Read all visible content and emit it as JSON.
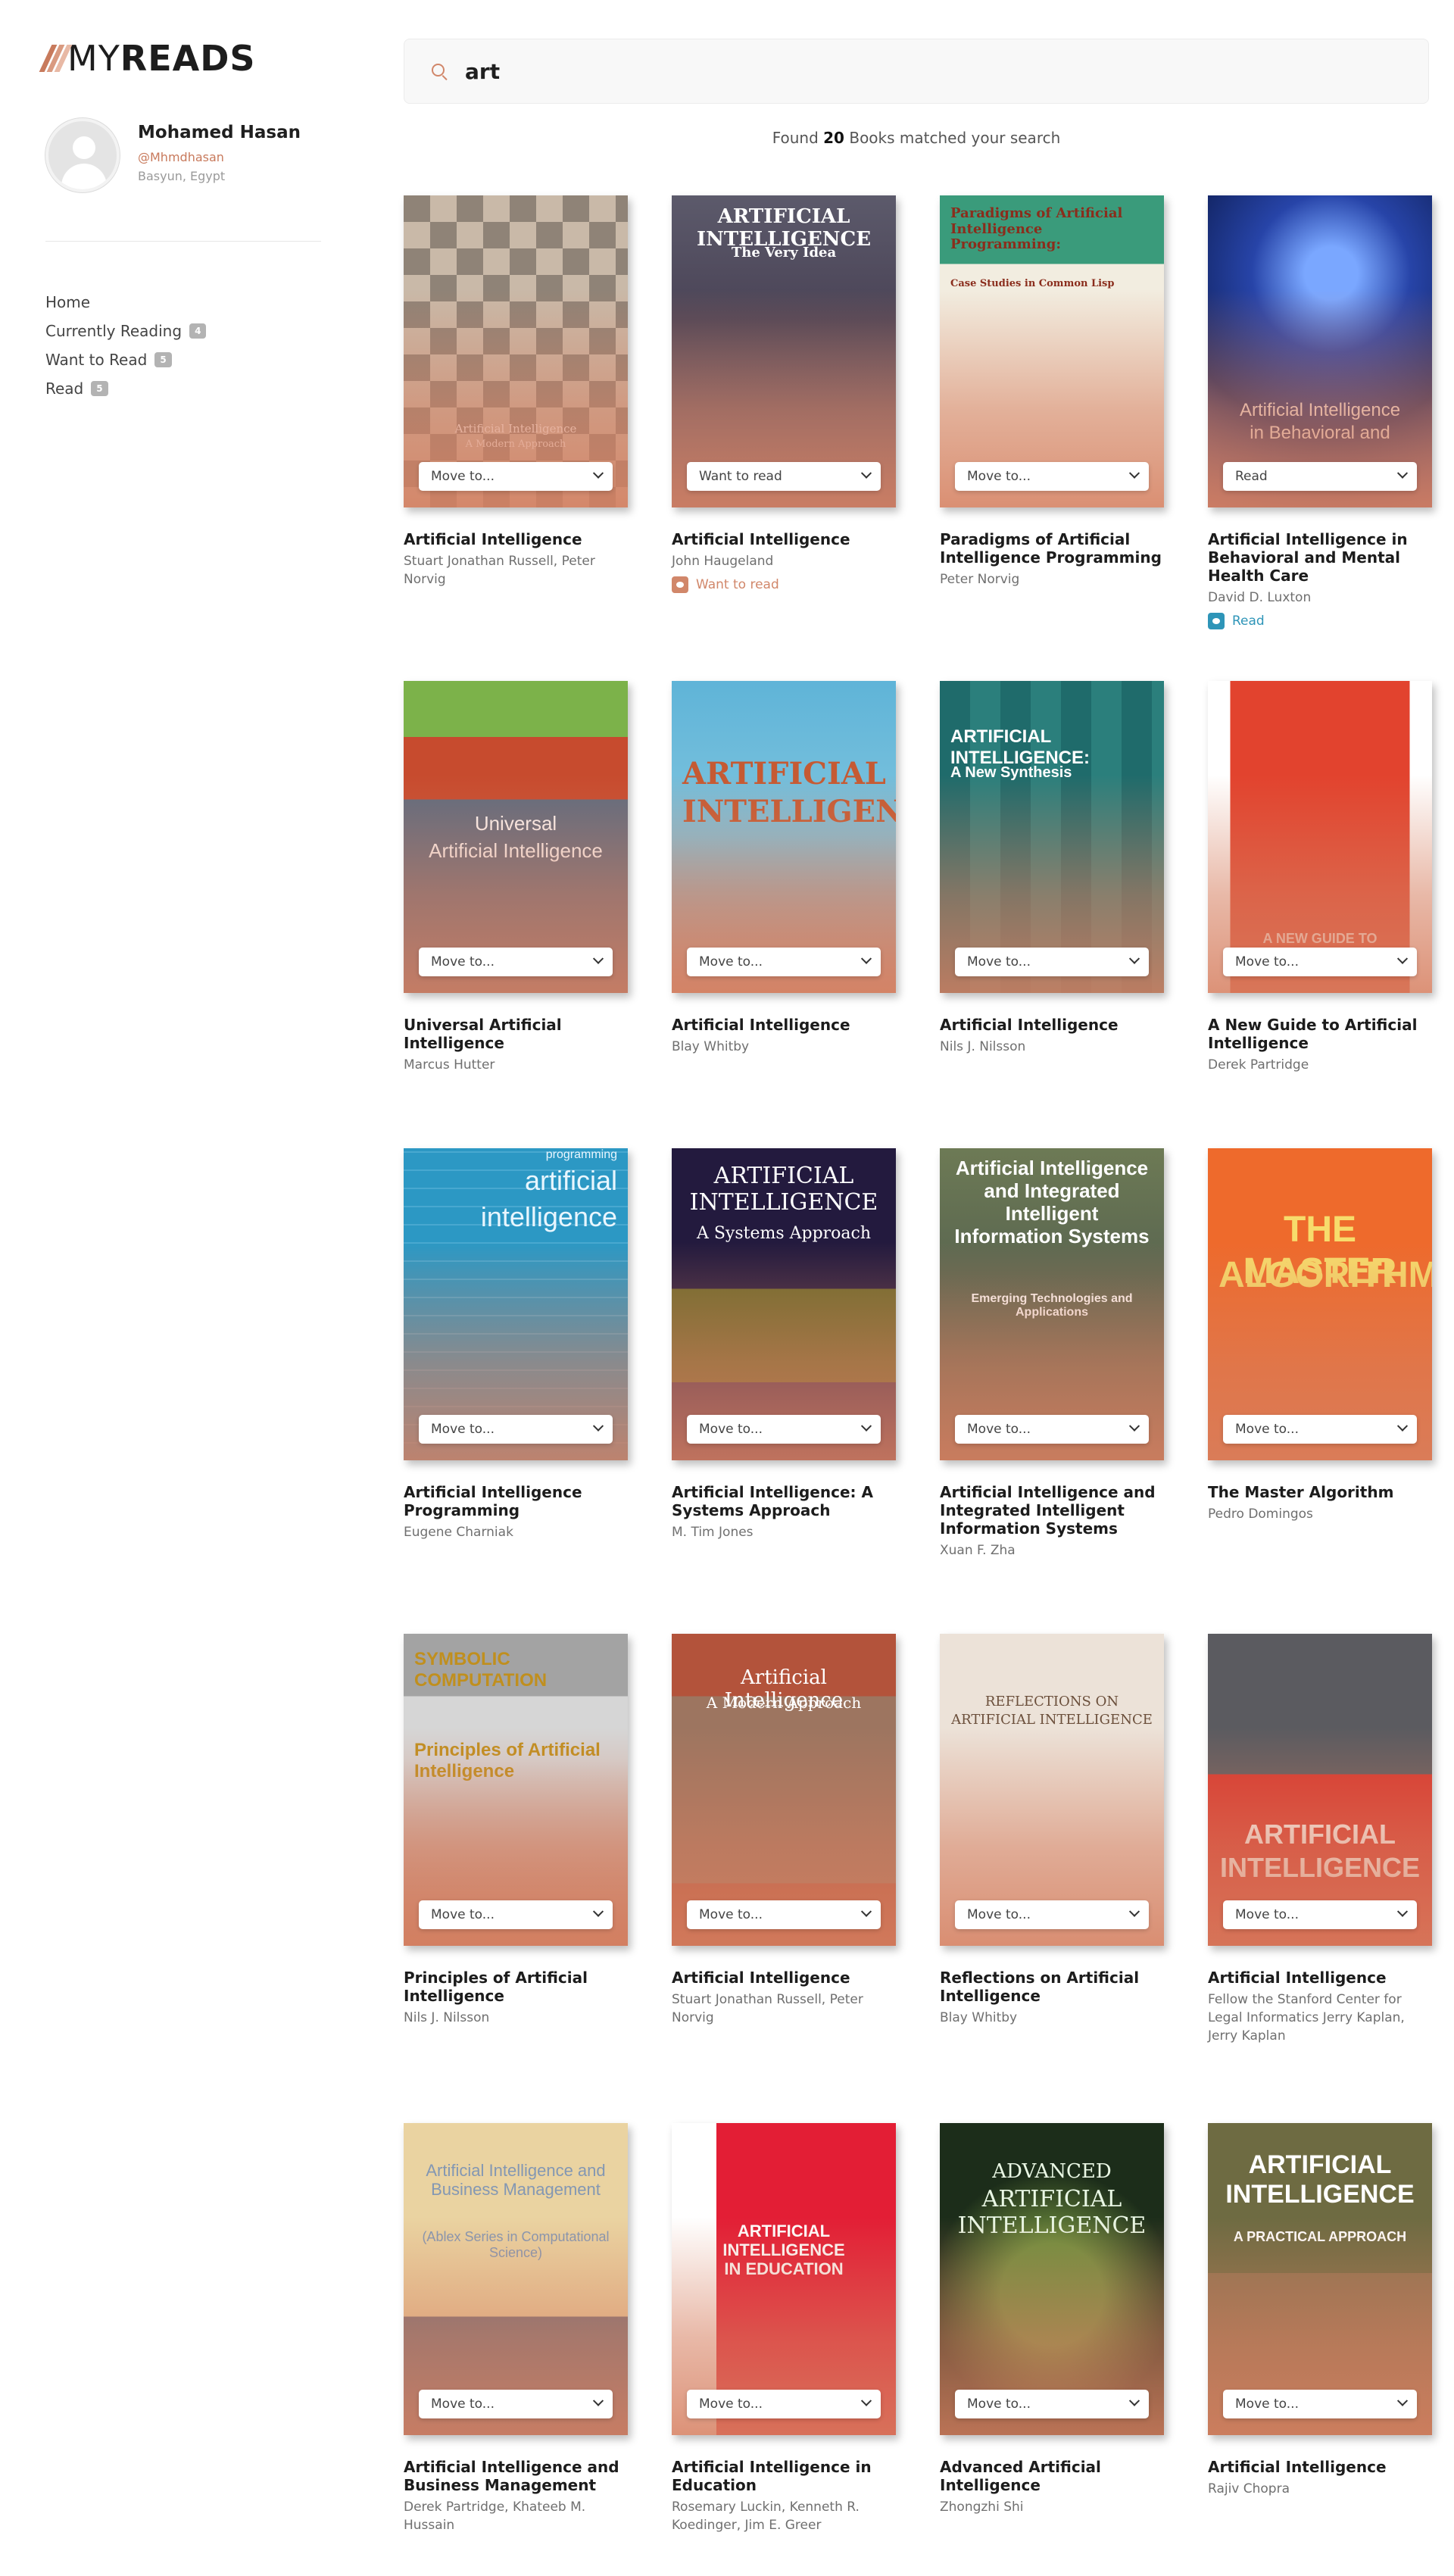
{
  "brand": {
    "logo_light": "MY",
    "logo_bold": "READS"
  },
  "profile": {
    "name": "Mohamed Hasan",
    "handle": "@Mhmdhasan",
    "location": "Basyun, Egypt"
  },
  "nav": [
    {
      "label": "Home",
      "badge": ""
    },
    {
      "label": "Currently Reading",
      "badge": "4"
    },
    {
      "label": "Want to Read",
      "badge": "5"
    },
    {
      "label": "Read",
      "badge": "5"
    }
  ],
  "search": {
    "value": "art",
    "placeholder": "Search by title or author"
  },
  "results": {
    "prefix": "Found",
    "count": "20",
    "suffix": "Books matched your search"
  },
  "colors": {
    "accent": "#c87a5c",
    "want_to_read": "#d1876a",
    "read": "#2e95b8"
  },
  "books": [
    {
      "title": "Artificial Intelligence",
      "authors": "Stuart Jonathan Russell, Peter Norvig",
      "shelf": "Move to...",
      "status": "",
      "cover_lines": [
        "Artificial Intelligence",
        "A Modern Approach"
      ]
    },
    {
      "title": "Artificial Intelligence",
      "authors": "John Haugeland",
      "shelf": "Want to read",
      "status": "Want to read",
      "cover_lines": [
        "ARTIFICIAL INTELLIGENCE",
        "The Very Idea"
      ]
    },
    {
      "title": "Paradigms of Artificial Intelligence Programming",
      "authors": "Peter Norvig",
      "shelf": "Move to...",
      "status": "",
      "cover_lines": [
        "Paradigms of Artificial Intelligence Programming:",
        "Case Studies in Common Lisp"
      ]
    },
    {
      "title": "Artificial Intelligence in Behavioral and Mental Health Care",
      "authors": "David D. Luxton",
      "shelf": "Read",
      "status": "Read",
      "cover_lines": [
        "Artificial Intelligence",
        "in Behavioral and"
      ]
    },
    {
      "title": "Universal Artificial Intelligence",
      "authors": "Marcus Hutter",
      "shelf": "Move to...",
      "status": "",
      "cover_lines": [
        "Universal",
        "Artificial Intelligence"
      ]
    },
    {
      "title": "Artificial Intelligence",
      "authors": "Blay Whitby",
      "shelf": "Move to...",
      "status": "",
      "cover_lines": [
        "ARTIFICIAL",
        "INTELLIGENCE"
      ]
    },
    {
      "title": "Artificial Intelligence",
      "authors": "Nils J. Nilsson",
      "shelf": "Move to...",
      "status": "",
      "cover_lines": [
        "ARTIFICIAL INTELLIGENCE:",
        "A New Synthesis"
      ]
    },
    {
      "title": "A New Guide to Artificial Intelligence",
      "authors": "Derek Partridge",
      "shelf": "Move to...",
      "status": "",
      "cover_lines": [
        "A NEW GUIDE TO",
        "INTELLIGENCE"
      ]
    },
    {
      "title": "Artificial Intelligence Programming",
      "authors": "Eugene Charniak",
      "shelf": "Move to...",
      "status": "",
      "cover_lines": [
        "artificial",
        "intelligence",
        "programming"
      ]
    },
    {
      "title": "Artificial Intelligence: A Systems Approach",
      "authors": "M. Tim Jones",
      "shelf": "Move to...",
      "status": "",
      "cover_lines": [
        "ARTIFICIAL INTELLIGENCE",
        "A Systems Approach"
      ]
    },
    {
      "title": "Artificial Intelligence and Integrated Intelligent Information Systems",
      "authors": "Xuan F. Zha",
      "shelf": "Move to...",
      "status": "",
      "cover_lines": [
        "Artificial Intelligence and Integrated Intelligent Information Systems",
        "Emerging Technologies and Applications"
      ]
    },
    {
      "title": "The Master Algorithm",
      "authors": "Pedro Domingos",
      "shelf": "Move to...",
      "status": "",
      "cover_lines": [
        "THE MASTER",
        "ALGORITHM"
      ]
    },
    {
      "title": "Principles of Artificial Intelligence",
      "authors": "Nils J. Nilsson",
      "shelf": "Move to...",
      "status": "",
      "cover_lines": [
        "SYMBOLIC COMPUTATION",
        "Principles of Artificial Intelligence"
      ]
    },
    {
      "title": "Artificial Intelligence",
      "authors": "Stuart Jonathan Russell, Peter Norvig",
      "shelf": "Move to...",
      "status": "",
      "cover_lines": [
        "Artificial Intelligence",
        "A Modern Approach"
      ]
    },
    {
      "title": "Reflections on Artificial Intelligence",
      "authors": "Blay Whitby",
      "shelf": "Move to...",
      "status": "",
      "cover_lines": [
        "REFLECTIONS ON",
        "ARTIFICIAL INTELLIGENCE"
      ]
    },
    {
      "title": "Artificial Intelligence",
      "authors": "Fellow the Stanford Center for Legal Informatics Jerry Kaplan, Jerry Kaplan",
      "shelf": "Move to...",
      "status": "",
      "cover_lines": [
        "ARTIFICIAL",
        "INTELLIGENCE"
      ]
    },
    {
      "title": "Artificial Intelligence and Business Management",
      "authors": "Derek Partridge, Khateeb M. Hussain",
      "shelf": "Move to...",
      "status": "",
      "cover_lines": [
        "Artificial Intelligence and Business Management",
        "(Ablex Series in Computational Science)"
      ]
    },
    {
      "title": "Artificial Intelligence in Education",
      "authors": "Rosemary Luckin, Kenneth R. Koedinger, Jim E. Greer",
      "shelf": "Move to...",
      "status": "",
      "cover_lines": [
        "ARTIFICIAL INTELLIGENCE",
        "IN EDUCATION"
      ]
    },
    {
      "title": "Advanced Artificial Intelligence",
      "authors": "Zhongzhi Shi",
      "shelf": "Move to...",
      "status": "",
      "cover_lines": [
        "ADVANCED",
        "ARTIFICIAL INTELLIGENCE"
      ]
    },
    {
      "title": "Artificial Intelligence",
      "authors": "Rajiv Chopra",
      "shelf": "Move to...",
      "status": "",
      "cover_lines": [
        "ARTIFICIAL INTELLIGENCE",
        "A PRACTICAL APPROACH"
      ]
    }
  ]
}
